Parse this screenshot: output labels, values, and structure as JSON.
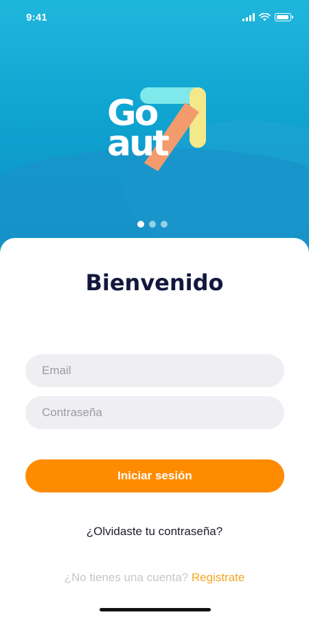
{
  "status_bar": {
    "time": "9:41"
  },
  "hero": {
    "logo_line1": "Go",
    "logo_line2": "aut",
    "carousel_dots": 3,
    "carousel_active_index": 0
  },
  "login": {
    "title": "Bienvenido",
    "email_placeholder": "Email",
    "password_placeholder": "Contraseña",
    "submit_label": "Iniciar sesión",
    "forgot_password": "¿Olvidaste tu contraseña?",
    "signup_prompt": "¿No tienes una cuenta?",
    "signup_link": "Registrate"
  },
  "colors": {
    "hero_blue": "#0fa3d0",
    "accent_orange": "#ff8c00",
    "title_navy": "#13183d",
    "link_yellow": "#f2a623"
  },
  "icons": [
    "signal-icon",
    "wifi-icon",
    "battery-icon",
    "logo-arrow-icon"
  ]
}
